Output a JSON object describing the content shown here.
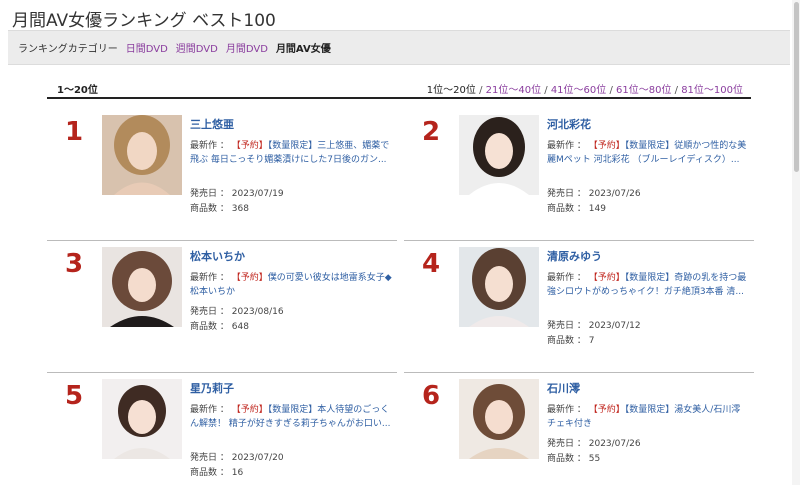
{
  "page": {
    "title": "月間AV女優ランキング ベスト100"
  },
  "category": {
    "label": "ランキングカテゴリー",
    "links": [
      "日間DVD",
      "週間DVD",
      "月間DVD"
    ],
    "current": "月間AV女優"
  },
  "range": {
    "current": "1〜20位",
    "links": [
      "1位〜20位",
      "21位〜40位",
      "41位〜60位",
      "61位〜80位",
      "81位〜100位"
    ],
    "separator": " / "
  },
  "labels": {
    "latest": "最新作 ：",
    "release": "発売日 ：",
    "count": "商品数 ："
  },
  "entries": [
    {
      "rank": "1",
      "name": "三上悠亜",
      "tag1": "【予約】",
      "tag2": "【数量限定】",
      "title": "三上悠亜、媚薬で飛ぶ 毎日こっそり媚薬漬けにした7日後のガン...",
      "release": "2023/07/19",
      "count": "368"
    },
    {
      "rank": "2",
      "name": "河北彩花",
      "tag1": "【予約】",
      "tag2": "【数量限定】",
      "title": "従順かつ性的な美麗Mペット 河北彩花 （ブルーレイディスク）...",
      "release": "2023/07/26",
      "count": "149"
    },
    {
      "rank": "3",
      "name": "松本いちか",
      "tag1": "【予約】",
      "tag2": "",
      "title": "僕の可愛い彼女は地雷系女子◆ 松本いちか",
      "release": "2023/08/16",
      "count": "648"
    },
    {
      "rank": "4",
      "name": "清原みゆう",
      "tag1": "【予約】",
      "tag2": "【数量限定】",
      "title": "奇跡の乳を持つ最強シロウトがめっちゃイク！ガチ絶頂3本番 清...",
      "release": "2023/07/12",
      "count": "7"
    },
    {
      "rank": "5",
      "name": "星乃莉子",
      "tag1": "【予約】",
      "tag2": "【数量限定】",
      "title": "本人待望のごっくん解禁！ 精子が好きすぎる莉子ちゃんがお口い...",
      "release": "2023/07/20",
      "count": "16"
    },
    {
      "rank": "6",
      "name": "石川澪",
      "tag1": "【予約】",
      "tag2": "【数量限定】",
      "title": "湯女美人/石川澪 チェキ付き",
      "release": "2023/07/26",
      "count": "55"
    }
  ]
}
